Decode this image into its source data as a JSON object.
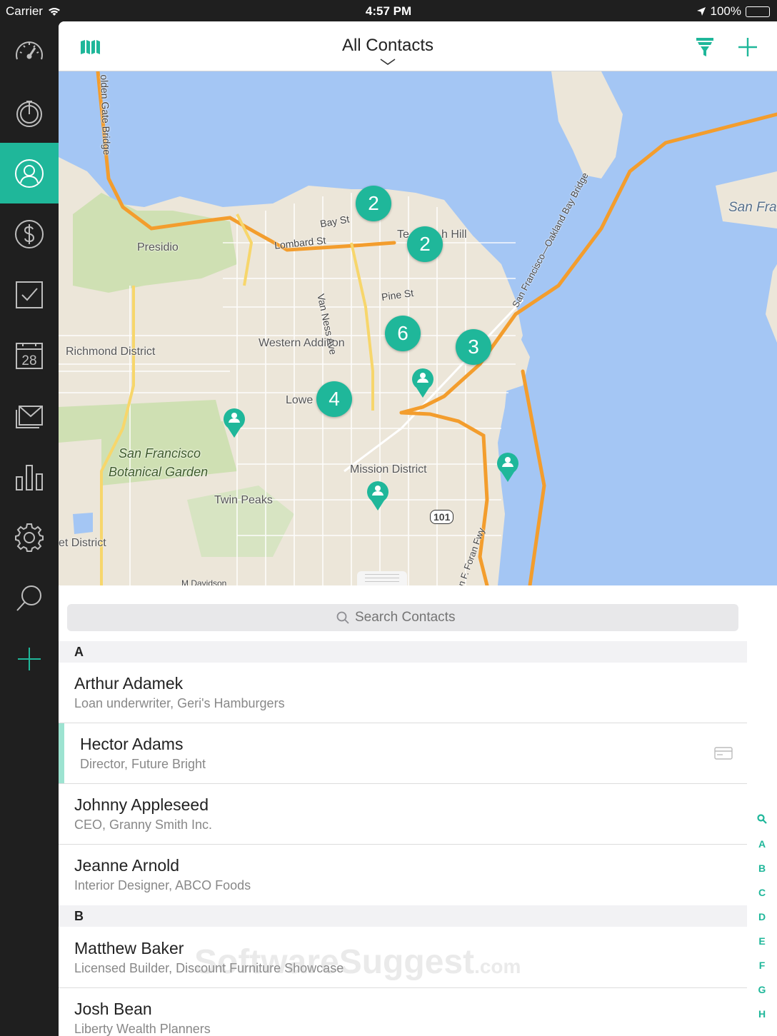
{
  "status": {
    "carrier": "Carrier",
    "time": "4:57 PM",
    "battery": "100%"
  },
  "sidebar": {
    "items": [
      {
        "name": "dashboard",
        "icon": "speedometer-icon",
        "active": false
      },
      {
        "name": "timer",
        "icon": "timer-icon",
        "active": false
      },
      {
        "name": "contacts",
        "icon": "contacts-icon",
        "active": true
      },
      {
        "name": "deals",
        "icon": "dollar-icon",
        "active": false
      },
      {
        "name": "tasks",
        "icon": "checkbox-icon",
        "active": false
      },
      {
        "name": "calendar",
        "icon": "calendar-icon",
        "active": false
      },
      {
        "name": "mail",
        "icon": "mail-icon",
        "active": false
      },
      {
        "name": "reports",
        "icon": "bar-chart-icon",
        "active": false
      },
      {
        "name": "settings",
        "icon": "gear-icon",
        "active": false
      },
      {
        "name": "search",
        "icon": "search-icon",
        "active": false
      },
      {
        "name": "add",
        "icon": "plus-icon",
        "active": false
      }
    ],
    "calendar_day": "28"
  },
  "nav": {
    "title": "All Contacts",
    "left_icon": "map-icon",
    "right_icons": [
      "filter-icon",
      "plus-icon"
    ]
  },
  "accent_color": "#1fb79a",
  "map": {
    "clusters": [
      "2",
      "2",
      "6",
      "3",
      "4"
    ],
    "labels": {
      "presidio": "Presidio",
      "richmond": "Richmond District",
      "western_addition": "Western Addition",
      "botanical1": "San Francisco",
      "botanical2": "Botanical Garden",
      "twin_peaks": "Twin Peaks",
      "mission": "Mission District",
      "sunset": "et District",
      "lower": "Lowe",
      "telegraph": "Te",
      "telegraph2": "h Hill",
      "san_fra": "San Fra",
      "bay_st": "Bay St",
      "lombard": "Lombard St",
      "van_ness": "Van Ness Ave",
      "pine": "Pine St",
      "golden_gate": "olden Gate Bridge",
      "bay_bridge": "San Francisco—Oakland Bay Bridge",
      "highway": "101",
      "foran": "n F. Foran Fwy",
      "davidson": "M Davidson"
    }
  },
  "search": {
    "placeholder": "Search Contacts"
  },
  "contacts": {
    "section_a": "A",
    "section_b": "B",
    "rows": [
      {
        "name": "Arthur Adamek",
        "subtitle": "Loan underwriter, Geri's Hamburgers"
      },
      {
        "name": "Hector Adams",
        "subtitle": "Director, Future Bright"
      },
      {
        "name": "Johnny Appleseed",
        "subtitle": "CEO, Granny Smith Inc."
      },
      {
        "name": "Jeanne Arnold",
        "subtitle": "Interior Designer, ABCO Foods"
      },
      {
        "name": "Matthew Baker",
        "subtitle": "Licensed Builder, Discount Furniture Showcase"
      },
      {
        "name": "Josh Bean",
        "subtitle": "Liberty Wealth Planners"
      }
    ]
  },
  "index_letters": [
    "A",
    "B",
    "C",
    "D",
    "E",
    "F",
    "G",
    "H"
  ],
  "watermark": {
    "main": "SoftwareSuggest",
    "suffix": ".com"
  }
}
